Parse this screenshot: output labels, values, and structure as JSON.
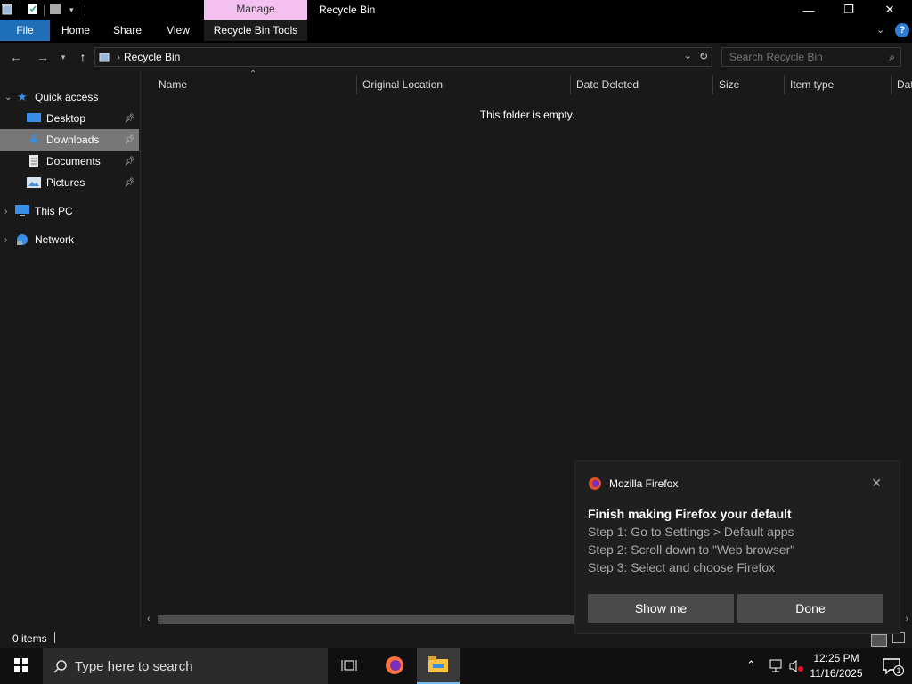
{
  "window": {
    "title": "Recycle Bin",
    "context_tab": "Manage"
  },
  "ribbon": {
    "tabs": [
      "File",
      "Home",
      "Share",
      "View",
      "Recycle Bin Tools"
    ]
  },
  "address": {
    "path": "Recycle Bin",
    "search_placeholder": "Search Recycle Bin"
  },
  "nav": {
    "quick_access": "Quick access",
    "items": [
      {
        "label": "Desktop",
        "icon": "desktop-icon",
        "pinned": true
      },
      {
        "label": "Downloads",
        "icon": "downloads-icon",
        "pinned": true,
        "selected": true
      },
      {
        "label": "Documents",
        "icon": "documents-icon",
        "pinned": true
      },
      {
        "label": "Pictures",
        "icon": "pictures-icon",
        "pinned": true
      }
    ],
    "this_pc": "This PC",
    "network": "Network"
  },
  "columns": [
    "Name",
    "Original Location",
    "Date Deleted",
    "Size",
    "Item type",
    "Dat"
  ],
  "content": {
    "empty_message": "This folder is empty."
  },
  "status": {
    "items": "0 items"
  },
  "toast": {
    "app": "Mozilla Firefox",
    "headline": "Finish making Firefox your default",
    "steps": [
      "Step 1: Go to Settings > Default apps",
      "Step 2: Scroll down to \"Web browser\"",
      "Step 3: Select and choose Firefox"
    ],
    "show_me": "Show me",
    "done": "Done"
  },
  "taskbar": {
    "search_placeholder": "Type here to search",
    "time": "12:25 PM",
    "date": "11/16/2025",
    "notification_count": "1"
  },
  "colors": {
    "accent": "#1f6fb8",
    "manage_tab": "#f3c0f0",
    "selected": "#777777",
    "background": "#191919"
  }
}
